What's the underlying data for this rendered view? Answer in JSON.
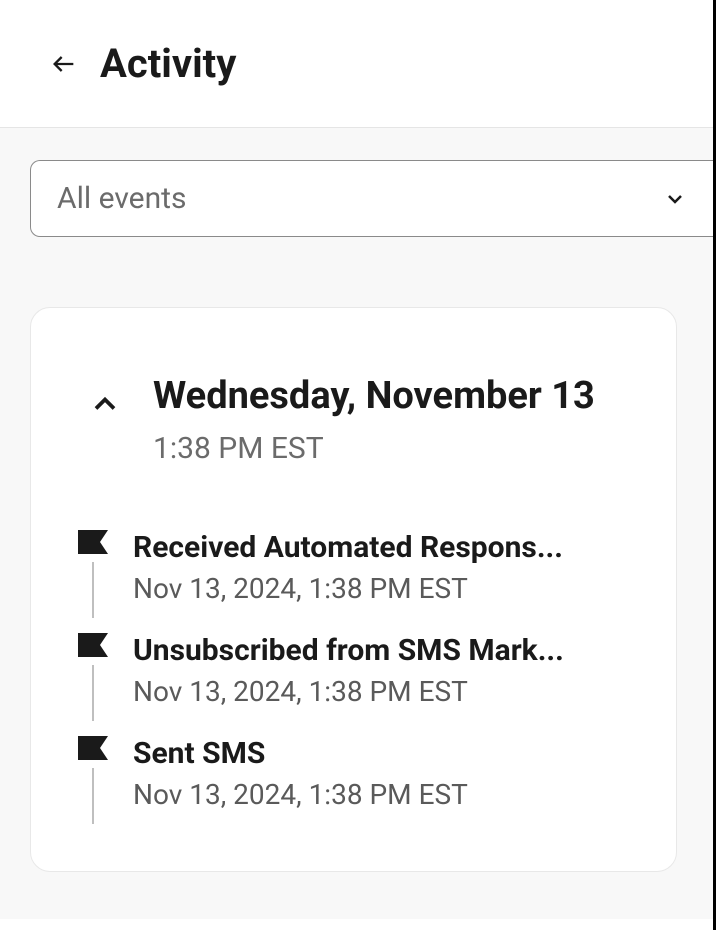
{
  "header": {
    "title": "Activity"
  },
  "filter": {
    "selected_label": "All events"
  },
  "day_group": {
    "title": "Wednesday, November 13",
    "time": "1:38 PM EST",
    "events": [
      {
        "title": "Received Automated Respons...",
        "timestamp": "Nov 13, 2024, 1:38 PM EST"
      },
      {
        "title": "Unsubscribed from SMS Mark...",
        "timestamp": "Nov 13, 2024, 1:38 PM EST"
      },
      {
        "title": "Sent SMS",
        "timestamp": "Nov 13, 2024, 1:38 PM EST"
      }
    ]
  }
}
